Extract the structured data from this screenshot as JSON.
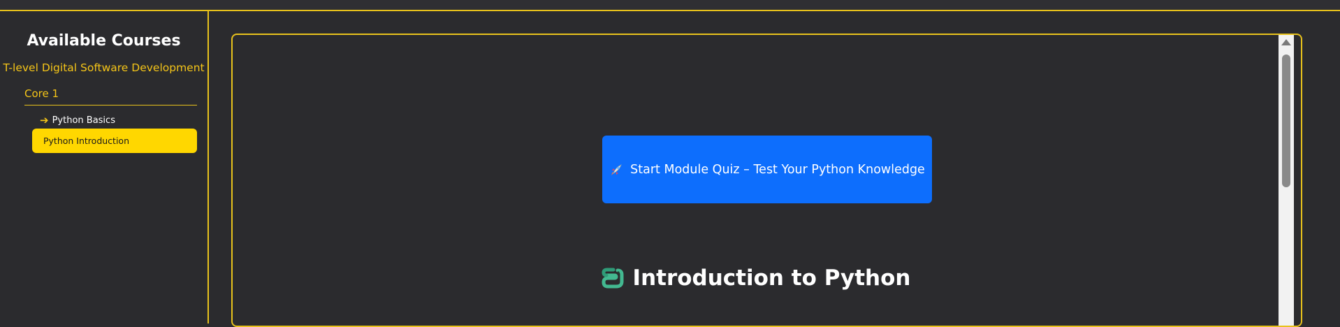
{
  "sidebar": {
    "title": "Available Courses",
    "course": "T-level Digital Software Development",
    "core": "Core 1",
    "module": "Python Basics",
    "lesson": "Python Introduction"
  },
  "main": {
    "quiz_button_label": "Start Module Quiz – Test Your Python Knowledge",
    "heading": "Introduction to Python"
  },
  "icons": {
    "module": "arrow-right-icon",
    "quiz": "rocket-icon",
    "heading": "python-snake-icon"
  },
  "colors": {
    "accent": "#f5c518",
    "active_item": "#ffd700",
    "button": "#0d6efd",
    "background": "#2b2b2e"
  }
}
